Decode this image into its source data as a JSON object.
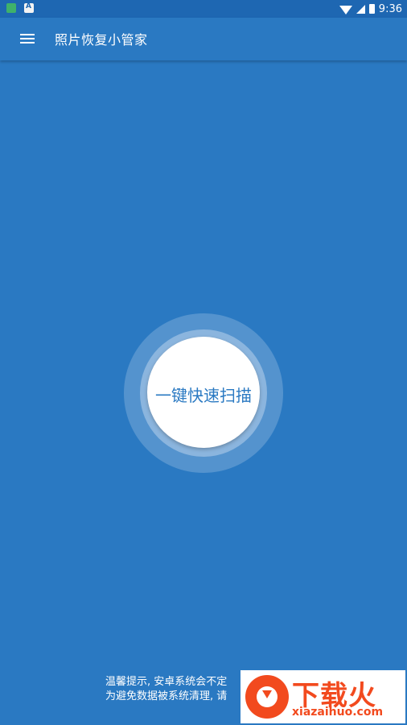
{
  "status_bar": {
    "time": "9:36",
    "icons": [
      "app-notification-icon",
      "keyboard-a-icon",
      "wifi-icon",
      "signal-icon",
      "battery-charging-icon"
    ]
  },
  "app_bar": {
    "title": "照片恢复小管家",
    "menu_icon": "hamburger-menu-icon"
  },
  "scan": {
    "label": "一键快速扫描"
  },
  "tip": {
    "line1": "温馨提示, 安卓系统会不定",
    "line2": "为避免数据被系统清理, 请"
  },
  "watermark": {
    "big_text": "下载火",
    "small_text": "xiazaihuo.com"
  },
  "colors": {
    "background": "#2a79c2",
    "status_bar": "#1e67b2",
    "accent_text": "#2a79c2",
    "watermark": "#f24a1e"
  }
}
